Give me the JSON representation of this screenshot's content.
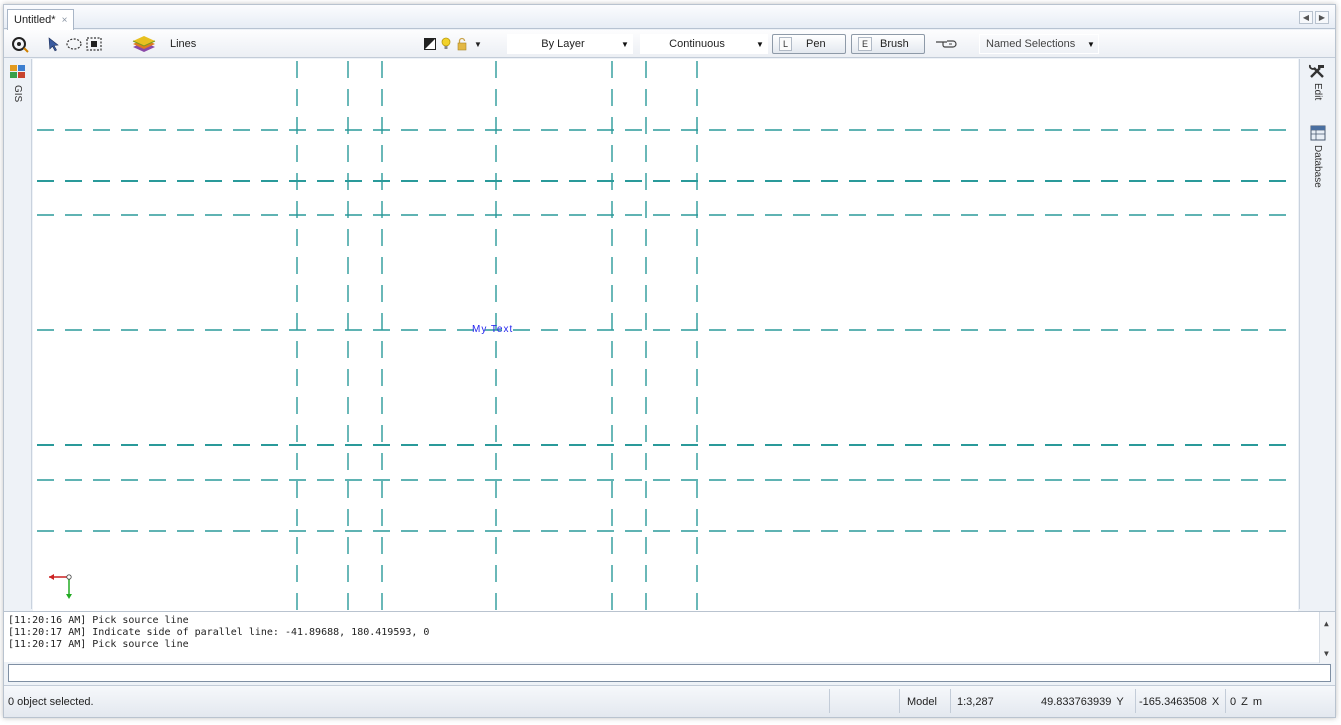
{
  "tab": {
    "title": "Untitled*",
    "close": "×"
  },
  "nav": {
    "prev": "◀",
    "next": "▶"
  },
  "toolbar": {
    "layer_name": "Lines",
    "linestyle_value": "By Layer",
    "linetype_value": "Continuous",
    "pen": {
      "key": "L",
      "label": "Pen"
    },
    "brush": {
      "key": "E",
      "label": "Brush"
    },
    "named_selections": "Named Selections"
  },
  "left_panel": {
    "label": "GIS"
  },
  "right_panel": {
    "edit_label": "Edit",
    "database_label": "Database"
  },
  "canvas": {
    "text_label": "My Text",
    "line_color": "#2a9a9a",
    "text_color": "#2222ee"
  },
  "log": {
    "lines": [
      "[11:20:16 AM] Pick source line",
      "[11:20:17 AM] Indicate side of parallel line: -41.89688, 180.419593, 0",
      "[11:20:17 AM] Pick source line"
    ]
  },
  "command": {
    "value": ""
  },
  "status": {
    "selection": "0 object selected.",
    "mode": "Model",
    "scale": "1:3,287",
    "y_value": "49.833763939",
    "y_label": "Y",
    "x_value": "-165.3463508",
    "x_label": "X",
    "z_value": "0",
    "z_label": "Z",
    "unit": "m"
  }
}
